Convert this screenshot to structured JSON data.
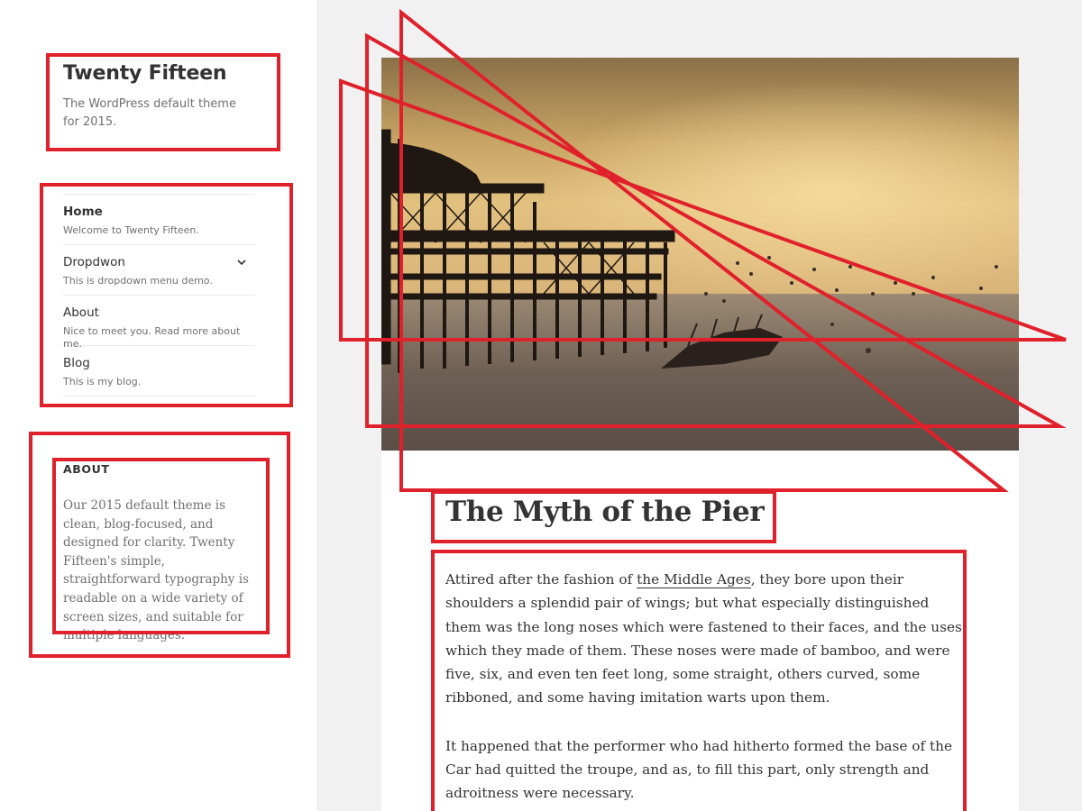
{
  "site": {
    "title": "Twenty Fifteen",
    "description": "The WordPress default theme for 2015."
  },
  "menu": {
    "items": [
      {
        "label": "Home",
        "description": "Welcome to Twenty Fifteen.",
        "current": true
      },
      {
        "label": "Dropdwon",
        "description": "This is dropdown menu demo.",
        "has_children": true
      },
      {
        "label": "About",
        "description": "Nice to meet you. Read more about me."
      },
      {
        "label": "Blog",
        "description": "This is my blog."
      }
    ]
  },
  "widget": {
    "title": "ABOUT",
    "text": "Our 2015 default theme is clean, blog-focused, and designed for clarity. Twenty Fifteen's simple, straightforward typography is readable on a wide variety of screen sizes, and suitable for multiple languages."
  },
  "post": {
    "title": "The Myth of the Pier",
    "paragraph_1_before_link": "Attired after the fashion of ",
    "paragraph_1_link": "the Middle Ages",
    "paragraph_1_after_link": ", they bore upon their shoulders a splendid pair of wings; but what especially distinguished them was the long noses which were fastened to their faces, and the uses which they made of them. These noses were made of bamboo, and were five, six, and even ten feet long, some straight, others curved, some ribboned, and some having imitation warts upon them.",
    "paragraph_2": "It happened that the performer who had hitherto formed the base of the Car had quitted the troupe, and as, to fill this part, only strength and adroitness were necessary."
  },
  "colors": {
    "annotation": "#e0202a",
    "background": "#f1f1f1",
    "panel": "#ffffff",
    "text": "#333333",
    "muted": "#707070"
  },
  "icons": {
    "dropdown": "chevron-down-icon"
  }
}
